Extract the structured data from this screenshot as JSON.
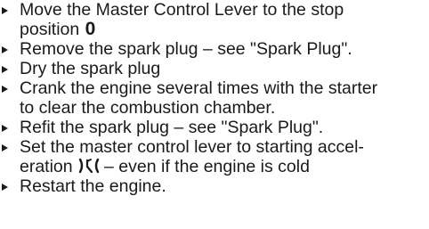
{
  "steps": [
    {
      "line1": "Move the Master Control Lever to the stop",
      "line2": "position",
      "symbol": "0"
    },
    {
      "line1": "Remove the spark plug – see \"Spark Plug\"."
    },
    {
      "line1": "Dry the spark plug"
    },
    {
      "line1": "Crank the engine several times with the starter",
      "line2": "to clear the combustion chamber."
    },
    {
      "line1": "Refit the spark plug – see \"Spark Plug\"."
    },
    {
      "line1": "Set the master control lever to starting accel-",
      "line2_before": "eration",
      "line2_after": "– even if the engine is cold",
      "symbol_icon": "starting-acceleration-symbol-icon"
    },
    {
      "line1": "Restart the engine."
    }
  ]
}
